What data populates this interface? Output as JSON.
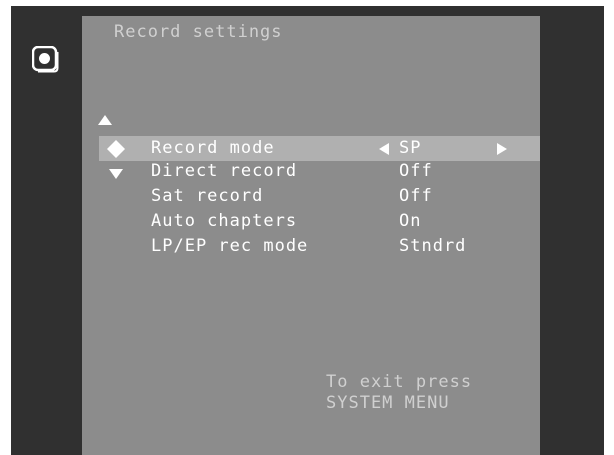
{
  "title": "Record settings",
  "menu": {
    "items": [
      {
        "label": "Record mode",
        "value": "SP"
      },
      {
        "label": "Direct record",
        "value": "Off"
      },
      {
        "label": "Sat record",
        "value": "Off"
      },
      {
        "label": "Auto chapters",
        "value": "On"
      },
      {
        "label": "LP/EP rec mode",
        "value": "Stndrd"
      }
    ]
  },
  "hint": {
    "line1": "To exit press",
    "line2": "SYSTEM MENU"
  },
  "icons": {
    "mode": "disc-icon",
    "nav_up": "up-arrow-icon",
    "nav_down": "down-arrow-icon",
    "selector": "diamond-selector-icon"
  },
  "colors": {
    "screen": "#303030",
    "panel": "#8c8c8c",
    "highlight": "#b0b0b0",
    "text": "#ffffff",
    "muted_text": "#d0d0d0"
  }
}
